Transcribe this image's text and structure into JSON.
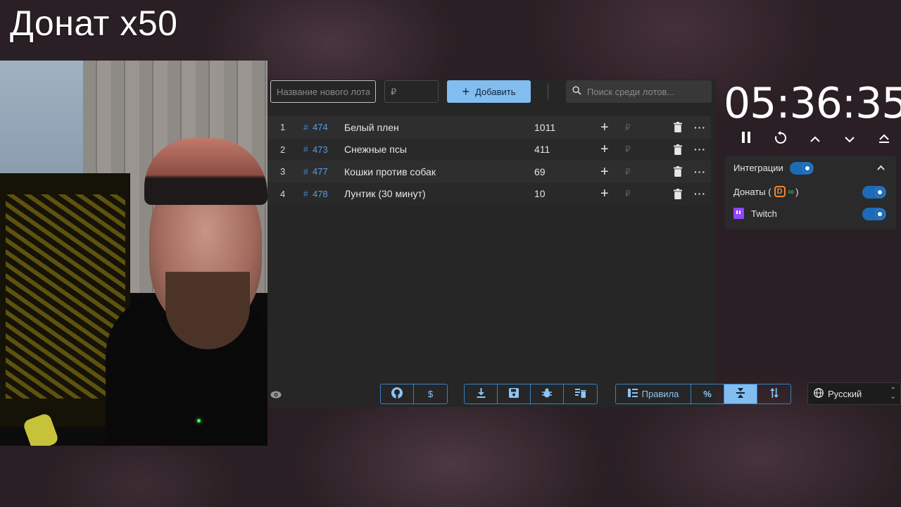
{
  "overlay": {
    "title": "Донат x50"
  },
  "topbar": {
    "lot_name_placeholder": "Название нового лота",
    "lot_price_placeholder": "₽",
    "add_label": "Добавить",
    "search_placeholder": "Поиск среди лотов..."
  },
  "lots": [
    {
      "num": "1",
      "id": "474",
      "name": "Белый плен",
      "amount": "1011"
    },
    {
      "num": "2",
      "id": "473",
      "name": "Снежные псы",
      "amount": "411"
    },
    {
      "num": "3",
      "id": "477",
      "name": "Кошки против собак",
      "amount": "69"
    },
    {
      "num": "4",
      "id": "478",
      "name": "Лунтик (30 минут)",
      "amount": "10"
    }
  ],
  "lot_currency": "₽",
  "bottombar": {
    "rules_label": "Правила",
    "percent_label": "%",
    "dollar_label": "$",
    "language": "Русский"
  },
  "timer": {
    "time": "05:36:35"
  },
  "integrations": {
    "header": "Интеграции",
    "enabled": true,
    "items": [
      {
        "label_prefix": "Донаты (",
        "label_suffix": " )",
        "enabled": true
      },
      {
        "label": "Twitch",
        "enabled": true
      }
    ]
  },
  "colors": {
    "accent": "#82bdf0",
    "toggle_on": "#1e6bb5",
    "lot_id": "#5a9be0",
    "donationalerts": "#e8893a",
    "donatepay": "#4bbf73",
    "twitch": "#9146ff"
  },
  "icons": {
    "github": "github-icon",
    "download": "download-icon",
    "save": "save-icon",
    "bug": "bug-icon",
    "clear": "clear-list-icon",
    "rules": "rules-icon",
    "sort": "sort-icon",
    "compress": "compress-icon"
  }
}
